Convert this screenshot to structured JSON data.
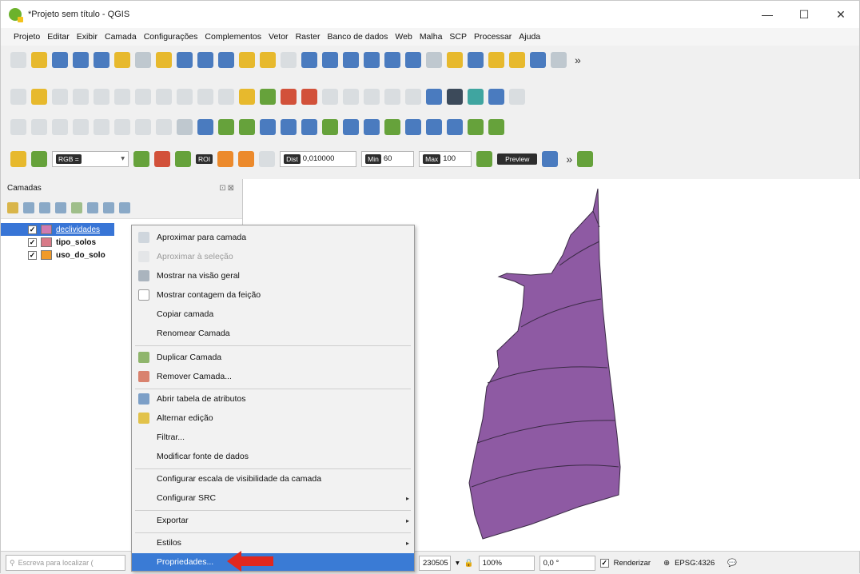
{
  "window": {
    "title": "*Projeto sem título - QGIS",
    "controls": [
      "—",
      "☐",
      "✕"
    ]
  },
  "menubar": [
    "Projeto",
    "Editar",
    "Exibir",
    "Camada",
    "Configurações",
    "Complementos",
    "Vetor",
    "Raster",
    "Banco de dados",
    "Web",
    "Malha",
    "SCP",
    "Processar",
    "Ajuda"
  ],
  "scp_toolbar": {
    "rgb": "RGB =",
    "roi": "ROI",
    "dist_tag": "Dist",
    "dist": "0,010000",
    "min_tag": "Min",
    "min": "60",
    "max_tag": "Max",
    "max": "100",
    "preview": "Preview"
  },
  "layers_panel": {
    "title": "Camadas",
    "controls": "⊡⊠",
    "layers": [
      {
        "name": "declividades",
        "checked": "✓",
        "color": "#d07ab0",
        "selected": true
      },
      {
        "name": "tipo_solos",
        "checked": "✓",
        "color": "#d87a88",
        "selected": false
      },
      {
        "name": "uso_do_solo",
        "checked": "✓",
        "color": "#f09a28",
        "selected": false
      }
    ]
  },
  "context_menu": {
    "items": [
      {
        "label": "Aproximar para camada",
        "icon": "zoom-layer-icon",
        "disabled": false
      },
      {
        "label": "Aproximar à seleção",
        "icon": "zoom-selection-icon",
        "disabled": true
      },
      {
        "label": "Mostrar na visão geral",
        "icon": "overview-icon",
        "disabled": false
      },
      {
        "label": "Mostrar contagem da feição",
        "icon": "checkbox-icon",
        "disabled": false
      },
      {
        "label": "Copiar camada",
        "icon": "",
        "disabled": false
      },
      {
        "label": "Renomear Camada",
        "icon": "",
        "disabled": false
      },
      {
        "label": "Duplicar Camada",
        "icon": "duplicate-layer-icon",
        "disabled": false
      },
      {
        "label": "Remover Camada...",
        "icon": "remove-layer-icon",
        "disabled": false
      },
      {
        "label": "Abrir tabela de atributos",
        "icon": "attribute-table-icon",
        "disabled": false
      },
      {
        "label": "Alternar edição",
        "icon": "pencil-icon",
        "disabled": false
      },
      {
        "label": "Filtrar...",
        "icon": "",
        "disabled": false
      },
      {
        "label": "Modificar fonte de dados",
        "icon": "",
        "disabled": false
      },
      {
        "label": "Configurar escala de visibilidade da camada",
        "icon": "",
        "disabled": false
      },
      {
        "label": "Configurar SRC",
        "icon": "",
        "disabled": false,
        "submenu": "▸"
      },
      {
        "label": "Exportar",
        "icon": "",
        "disabled": false,
        "submenu": "▸"
      },
      {
        "label": "Estilos",
        "icon": "",
        "disabled": false,
        "submenu": "▸"
      },
      {
        "label": "Propriedades...",
        "icon": "",
        "disabled": false,
        "highlighted": true
      }
    ]
  },
  "statusbar": {
    "locator_placeholder": "Escreva para localizar (",
    "scale": "230505",
    "magnifier": "100%",
    "rotation": "0,0 °",
    "render_check": "✓",
    "render_label": "Renderizar",
    "crs": "EPSG:4326"
  },
  "map": {
    "polygon_fill": "#8e5aa3",
    "polygon_stroke": "#3a2a45"
  }
}
